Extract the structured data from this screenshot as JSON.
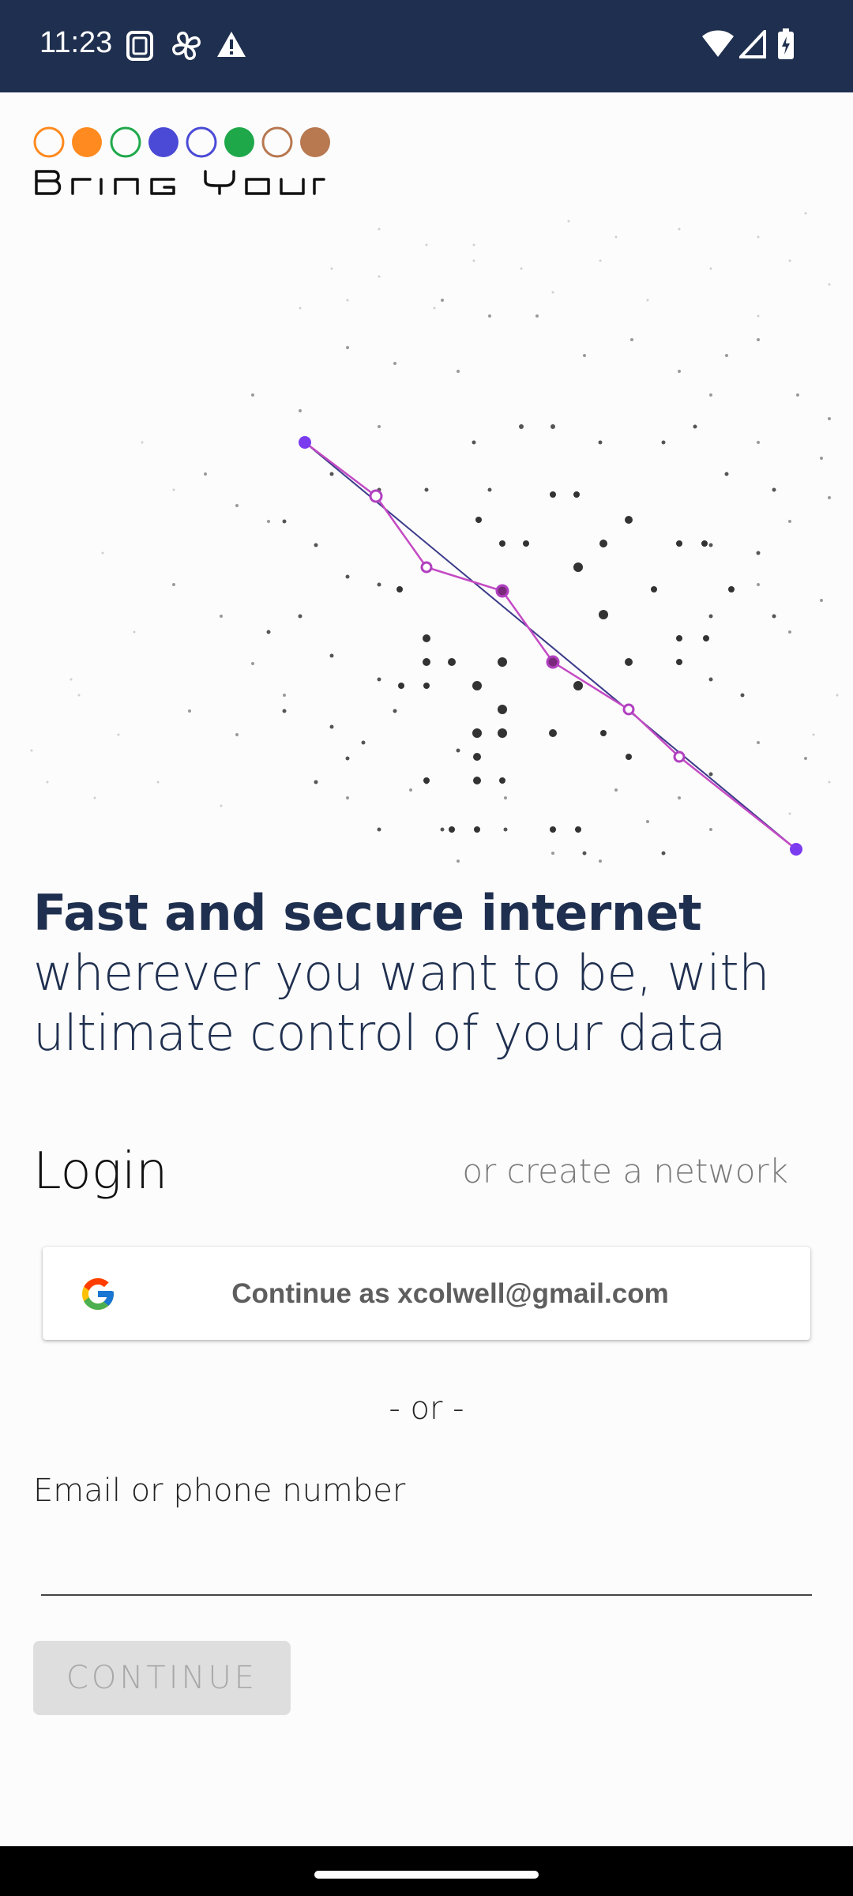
{
  "status_bar": {
    "time": "11:23",
    "left_icons": [
      "screenshot-icon",
      "pinwheel-icon",
      "warning-icon"
    ],
    "right_icons": [
      "wifi-icon",
      "cellular-signal-icon",
      "battery-charging-icon"
    ],
    "background": "#1f2f4f"
  },
  "brand": {
    "wordmark": "Bring Your",
    "dot_colors": [
      "#ff8a1f",
      "#ff8a1f",
      "#1fa84a",
      "#4a4ad6",
      "#4a4ad6",
      "#1fa84a",
      "#b87850",
      "#b87850"
    ]
  },
  "headline": {
    "strong": "Fast and secure internet",
    "rest": " wherever you want to be, with ultimate control of your data"
  },
  "login": {
    "title": "Login",
    "create_link": "or create a network",
    "google_button": "Continue as xcolwell@gmail.com",
    "separator": "- or -",
    "email_label": "Email or phone number",
    "email_value": "",
    "continue_button": "CONTINUE"
  },
  "colors": {
    "accent_purple": "#7b3cf0",
    "link_line": "#c44ac4",
    "text_dark": "#1f2f4f"
  }
}
